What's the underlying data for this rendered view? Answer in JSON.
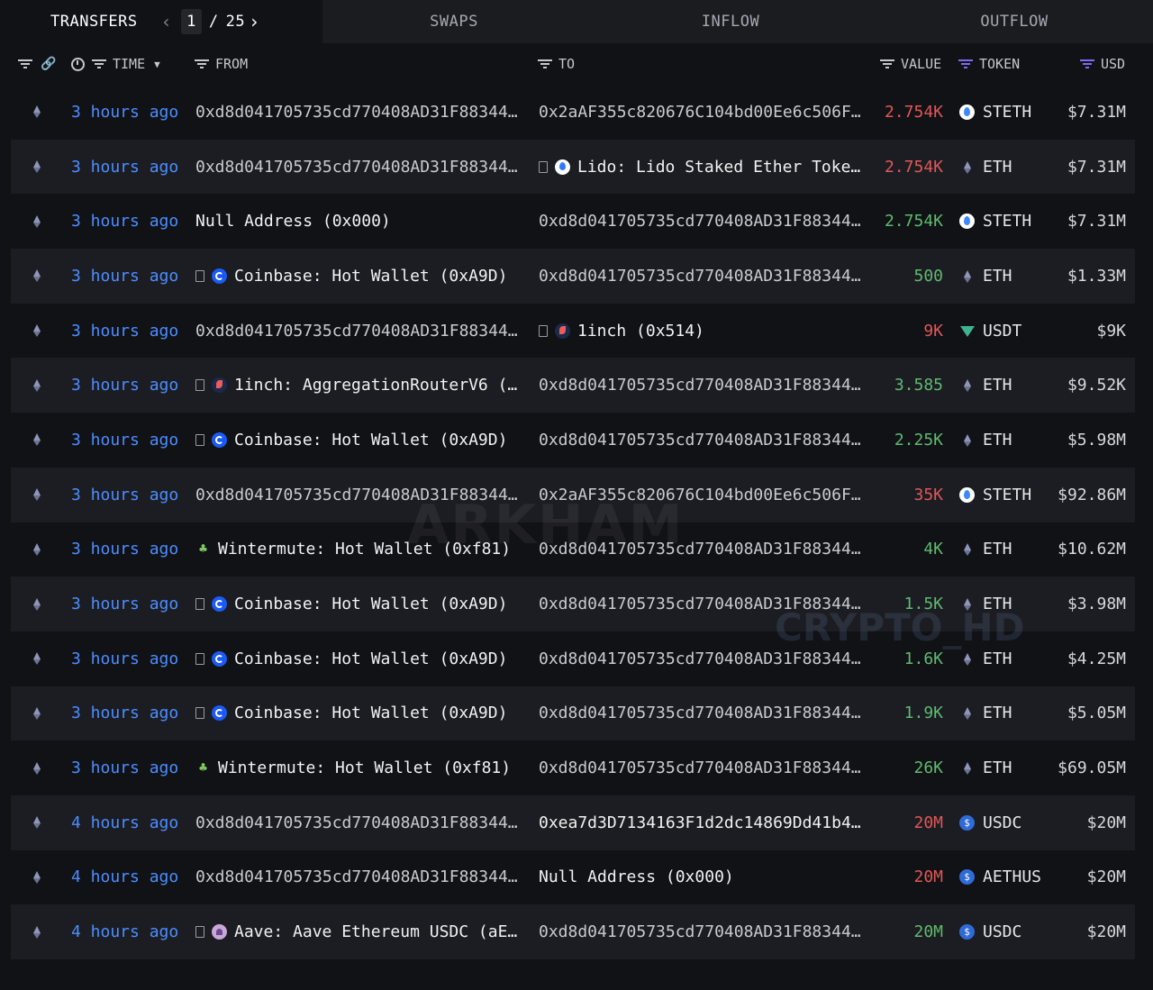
{
  "tabs": {
    "transfers": "TRANSFERS",
    "swaps": "SWAPS",
    "inflow": "INFLOW",
    "outflow": "OUTFLOW"
  },
  "pager": {
    "current": "1",
    "separator": "/",
    "total": "25"
  },
  "columns": {
    "time": "TIME",
    "from": "FROM",
    "to": "TO",
    "value": "VALUE",
    "token": "TOKEN",
    "usd": "USD"
  },
  "rows": [
    {
      "time": "3 hours ago",
      "from": "0xd8d041705735cd770408AD31F88344…",
      "to": "0x2aAF355c820676C104bd00Ee6c506F…",
      "value": "2.754K",
      "token": "STETH",
      "usd": "$7.31M"
    },
    {
      "time": "3 hours ago",
      "from": "0xd8d041705735cd770408AD31F88344…",
      "to": "Lido: Lido Staked Ether Toke…",
      "value": "2.754K",
      "token": "ETH",
      "usd": "$7.31M"
    },
    {
      "time": "3 hours ago",
      "from": "Null Address (0x000)",
      "to": "0xd8d041705735cd770408AD31F88344…",
      "value": "2.754K",
      "token": "STETH",
      "usd": "$7.31M"
    },
    {
      "time": "3 hours ago",
      "from": "Coinbase: Hot Wallet (0xA9D)",
      "to": "0xd8d041705735cd770408AD31F88344…",
      "value": "500",
      "token": "ETH",
      "usd": "$1.33M"
    },
    {
      "time": "3 hours ago",
      "from": "0xd8d041705735cd770408AD31F88344…",
      "to": "1inch (0x514)",
      "value": "9K",
      "token": "USDT",
      "usd": "$9K"
    },
    {
      "time": "3 hours ago",
      "from": "1inch: AggregationRouterV6 (…",
      "to": "0xd8d041705735cd770408AD31F88344…",
      "value": "3.585",
      "token": "ETH",
      "usd": "$9.52K"
    },
    {
      "time": "3 hours ago",
      "from": "Coinbase: Hot Wallet (0xA9D)",
      "to": "0xd8d041705735cd770408AD31F88344…",
      "value": "2.25K",
      "token": "ETH",
      "usd": "$5.98M"
    },
    {
      "time": "3 hours ago",
      "from": "0xd8d041705735cd770408AD31F88344…",
      "to": "0x2aAF355c820676C104bd00Ee6c506F…",
      "value": "35K",
      "token": "STETH",
      "usd": "$92.86M"
    },
    {
      "time": "3 hours ago",
      "from": "Wintermute: Hot Wallet (0xf81)",
      "to": "0xd8d041705735cd770408AD31F88344…",
      "value": "4K",
      "token": "ETH",
      "usd": "$10.62M"
    },
    {
      "time": "3 hours ago",
      "from": "Coinbase: Hot Wallet (0xA9D)",
      "to": "0xd8d041705735cd770408AD31F88344…",
      "value": "1.5K",
      "token": "ETH",
      "usd": "$3.98M"
    },
    {
      "time": "3 hours ago",
      "from": "Coinbase: Hot Wallet (0xA9D)",
      "to": "0xd8d041705735cd770408AD31F88344…",
      "value": "1.6K",
      "token": "ETH",
      "usd": "$4.25M"
    },
    {
      "time": "3 hours ago",
      "from": "Coinbase: Hot Wallet (0xA9D)",
      "to": "0xd8d041705735cd770408AD31F88344…",
      "value": "1.9K",
      "token": "ETH",
      "usd": "$5.05M"
    },
    {
      "time": "3 hours ago",
      "from": "Wintermute: Hot Wallet (0xf81)",
      "to": "0xd8d041705735cd770408AD31F88344…",
      "value": "26K",
      "token": "ETH",
      "usd": "$69.05M"
    },
    {
      "time": "4 hours ago",
      "from": "0xd8d041705735cd770408AD31F88344…",
      "to": "0xea7d3D7134163F1d2dc14869Dd41b4…",
      "value": "20M",
      "token": "USDC",
      "usd": "$20M"
    },
    {
      "time": "4 hours ago",
      "from": "0xd8d041705735cd770408AD31F88344…",
      "to": "Null Address (0x000)",
      "value": "20M",
      "token": "AETHUS",
      "usd": "$20M"
    },
    {
      "time": "4 hours ago",
      "from": "Aave: Aave Ethereum USDC (aE…",
      "to": "0xd8d041705735cd770408AD31F88344…",
      "value": "20M",
      "token": "USDC",
      "usd": "$20M"
    }
  ],
  "watermarks": {
    "arkham": "ARKHAM",
    "crypto": "CRYPTO_HD"
  },
  "colors": {
    "positive": "#5fba6f",
    "negative": "#e05757",
    "time_link": "#4c8dff",
    "accent_purple": "#7e6bf0"
  }
}
